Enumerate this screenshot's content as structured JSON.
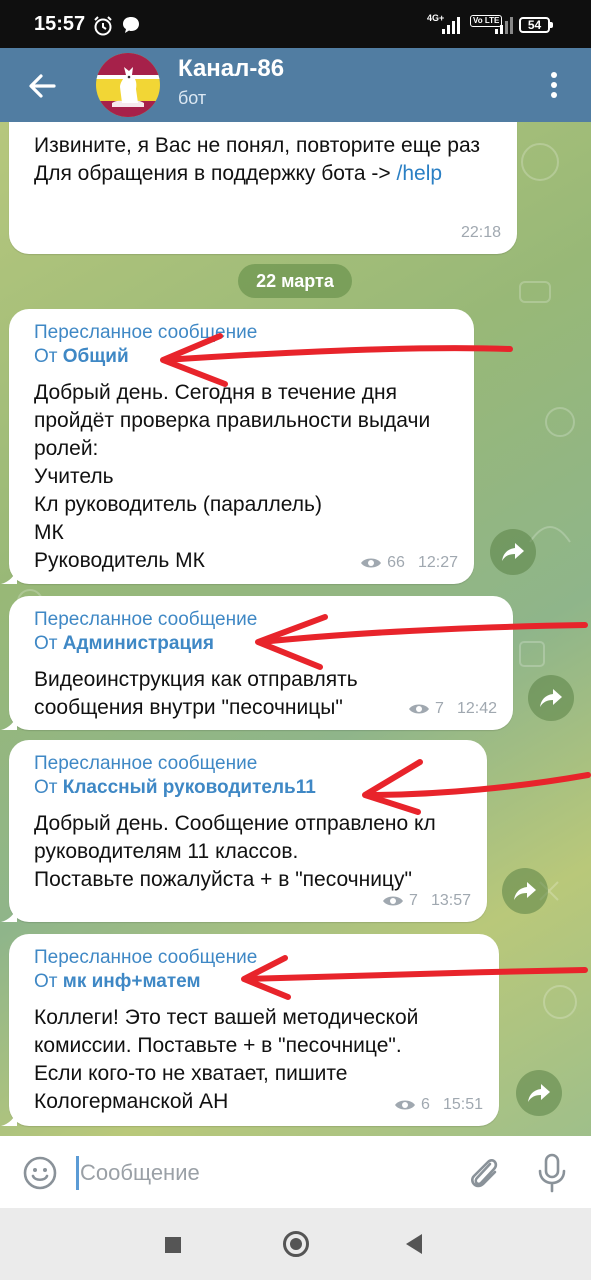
{
  "status_bar": {
    "time": "15:57",
    "network": "4G+",
    "volte": "Vo LTE",
    "battery": "54"
  },
  "header": {
    "title": "Канал-86",
    "subtitle": "бот"
  },
  "chat": {
    "first_message": {
      "text": "Извините, я Вас не понял, повторите еще раз\nДля обращения в поддержку бота -> ",
      "link": "/help",
      "time": "22:18"
    },
    "date_separator": "22 марта",
    "messages": [
      {
        "forward_label": "Пересланное сообщение",
        "from_prefix": "От ",
        "from_name": "Общий",
        "text": "Добрый день. Сегодня в течение дня пройдёт проверка правильности выдачи ролей:\nУчитель\nКл руководитель (параллель)\nМК\nРуководитель МК",
        "views": "66",
        "time": "12:27"
      },
      {
        "forward_label": "Пересланное сообщение",
        "from_prefix": "От ",
        "from_name": "Администрация",
        "text": "Видеоинструкция как отправлять сообщения внутри \"песочницы\"",
        "views": "7",
        "time": "12:42"
      },
      {
        "forward_label": "Пересланное сообщение",
        "from_prefix": "От ",
        "from_name": "Классный руководитель11",
        "text": "Добрый день. Сообщение отправлено кл руководителям 11 классов.\nПоставьте пожалуйста + в \"песочницу\"",
        "views": "7",
        "time": "13:57"
      },
      {
        "forward_label": "Пересланное сообщение",
        "from_prefix": "От ",
        "from_name": "мк инф+матем",
        "text": "Коллеги! Это тест вашей методической комиссии. Поставьте + в \"песочнице\".\nЕсли кого-то не хватает, пишите Кологерманской АН",
        "views": "6",
        "time": "15:51"
      }
    ]
  },
  "composer": {
    "placeholder": "Сообщение"
  },
  "colors": {
    "header_bg": "#517da2",
    "link": "#3f88c5",
    "annotation_arrow": "#e8242b"
  },
  "icons": {
    "back": "arrow-left-icon",
    "menu": "more-vertical-icon",
    "views": "eye-icon",
    "share": "share-icon",
    "emoji": "emoji-icon",
    "attach": "paperclip-icon",
    "mic": "microphone-icon"
  }
}
